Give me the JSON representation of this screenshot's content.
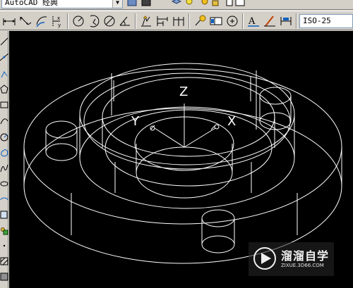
{
  "workspace": {
    "selected": "AutoCAD 经典"
  },
  "dimension_toolbar": {
    "dim_style": "ISO-25",
    "buttons": [
      "linear-dimension",
      "aligned-dimension",
      "arc-length",
      "ordinate",
      "radius",
      "jogged",
      "diameter",
      "angular",
      "quick-dimension",
      "baseline",
      "continue",
      "quick-leader",
      "tolerance",
      "center-mark",
      "dimension-edit",
      "dimension-text-edit",
      "dimension-update"
    ]
  },
  "drawing": {
    "axis_labels": {
      "z": "Z",
      "y": "Y",
      "x": "X"
    },
    "colors": {
      "background": "#000000",
      "lines": "#ffffff"
    }
  },
  "watermark": {
    "title": "溜溜自学",
    "url": "ZIXUE.3D66.COM"
  }
}
